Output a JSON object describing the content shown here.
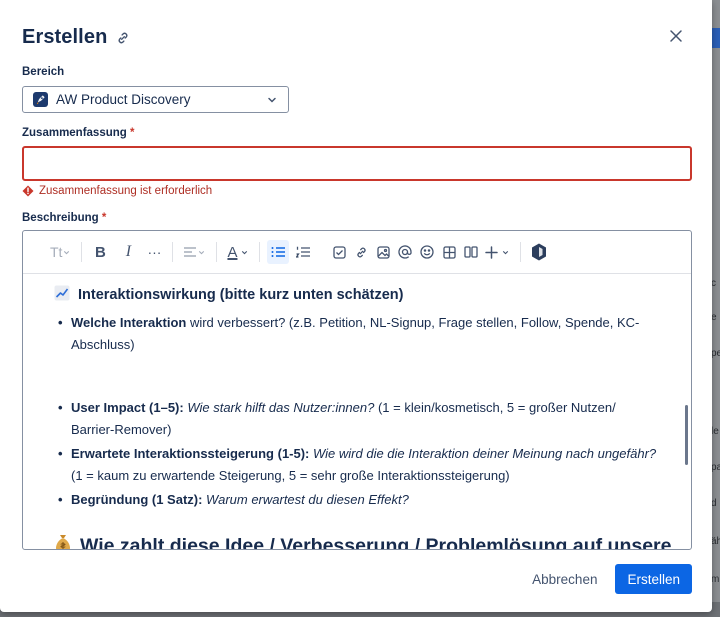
{
  "modal": {
    "title": "Erstellen",
    "close_label": "Schließen"
  },
  "bereich": {
    "label": "Bereich",
    "selected": "AW Product Discovery"
  },
  "zusammenfassung": {
    "label": "Zusammenfassung",
    "required": "*",
    "value": "",
    "error": "Zusammenfassung ist erforderlich"
  },
  "beschreibung": {
    "label": "Beschreibung",
    "required": "*"
  },
  "toolbar": {
    "text_style": "Tt",
    "bold": "B",
    "italic": "I",
    "more": "···",
    "text_color": "A"
  },
  "content": {
    "heading_emoji": "📈",
    "heading": "Interaktionswirkung (bitte kurz unten schätzen)",
    "bullet1_bold": "Welche Interaktion",
    "bullet1_text": " wird verbessert? (z.B. Petition, NL-Signup, Frage stellen, Follow, Spende, KC-Abschluss)",
    "bullet2_bold": "User Impact (1–5):",
    "bullet2_italic": " Wie stark hilft das Nutzer:innen?",
    "bullet2_text": " (1 = klein/kosmetisch, 5 = großer Nutzen/ Barrier-Remover)",
    "bullet3_bold": "Erwartete Interaktionssteigerung (1-5):",
    "bullet3_italic": " Wie wird die die Interaktion deiner Meinung nach ungefähr?",
    "bullet3_text": " (1 = kaum zu erwartende Steigerung, 5 = sehr große Interaktionssteigerung)",
    "bullet4_bold": "Begründung (1 Satz):",
    "bullet4_italic": " Warum erwartest du diesen Effekt?",
    "heading2_emoji": "💰",
    "heading2": "Wie zahlt diese Idee / Verbesserung / Problemlösung auf unsere"
  },
  "footer": {
    "cancel": "Abbrechen",
    "submit": "Erstellen"
  },
  "background": {
    "snippets": [
      "c",
      "e",
      "pe",
      "le",
      "pa",
      "d",
      "äh",
      "m",
      "·"
    ]
  },
  "colors": {
    "primary": "#0c66e4",
    "error": "#c9372c"
  }
}
